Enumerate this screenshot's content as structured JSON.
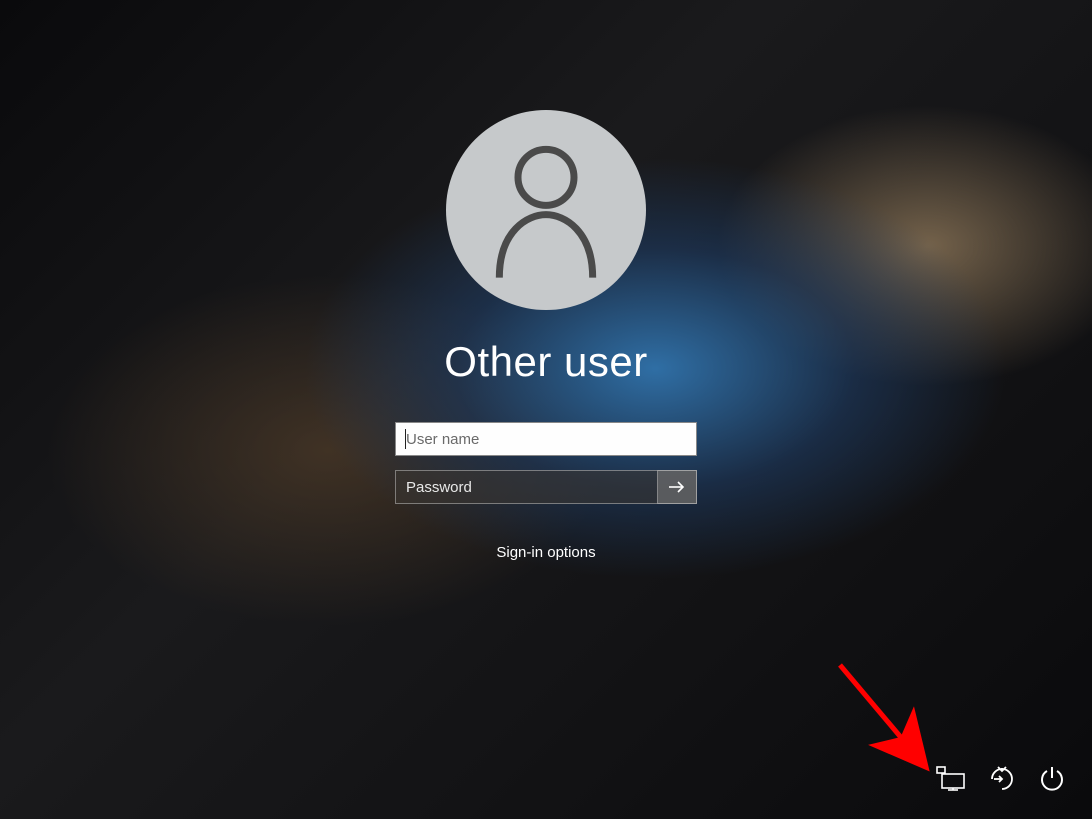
{
  "login": {
    "title": "Other user",
    "username_placeholder": "User name",
    "password_placeholder": "Password",
    "signin_options_label": "Sign-in options"
  },
  "icons": {
    "avatar": "user-silhouette",
    "submit": "arrow-right",
    "network": "network-icon",
    "ease_of_access": "ease-of-access-icon",
    "power": "power-icon"
  },
  "annotation": {
    "arrow_color": "#ff0000",
    "points_to": "network-icon"
  }
}
